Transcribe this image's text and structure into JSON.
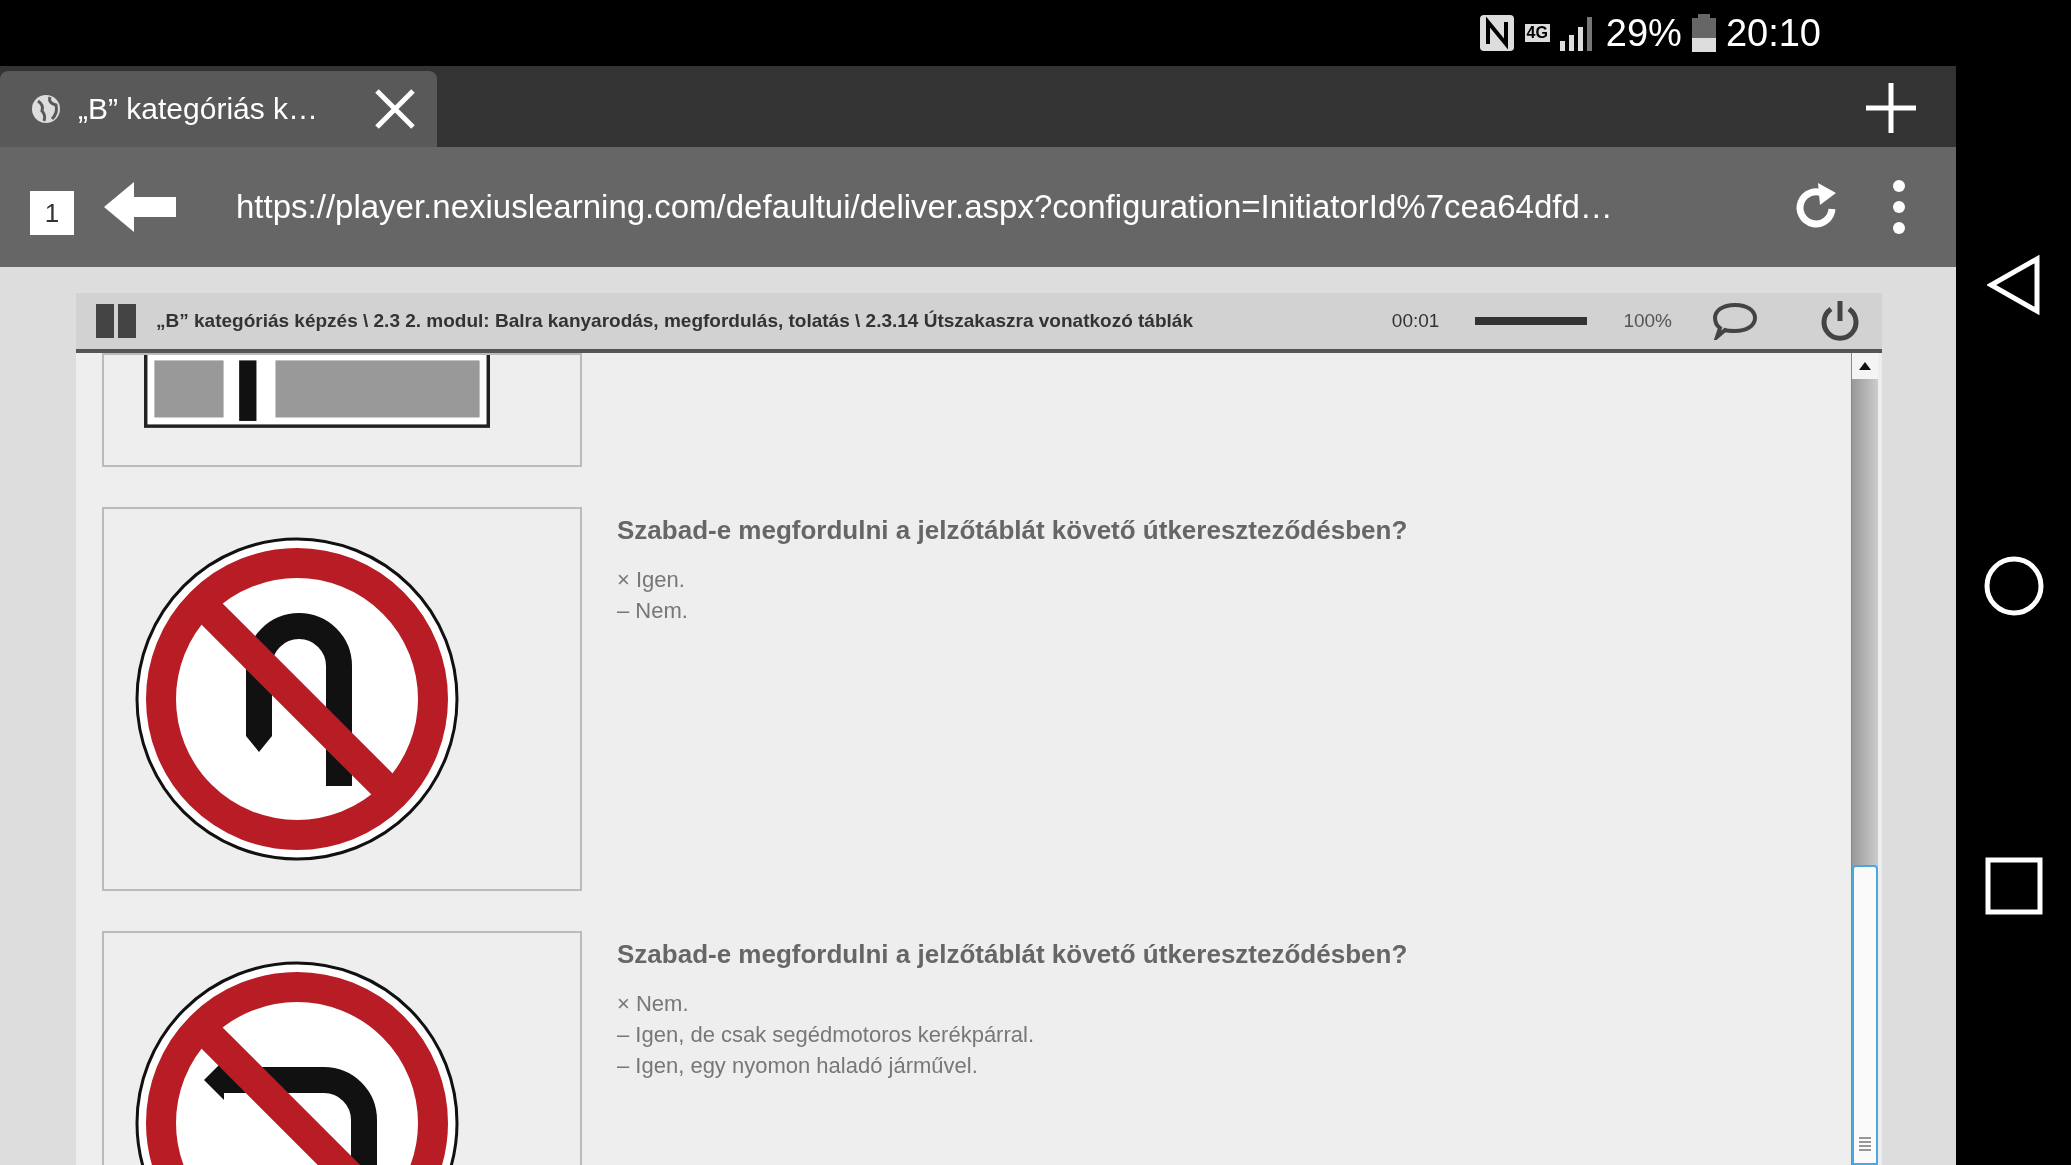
{
  "status_bar": {
    "network": "4G",
    "battery": "29%",
    "time": "20:10"
  },
  "browser": {
    "tab": {
      "title": "„B” kategóriás k…",
      "selected": true
    },
    "tab_count": "1",
    "url": "https://player.nexiuslearning.com/defaultui/deliver.aspx?configuration=InitiatorId%7cea64dfd…"
  },
  "player": {
    "breadcrumb": "„B” kategóriás képzés \\ 2.3 2. modul: Balra kanyarodás, megfordulás, tolatás \\ 2.3.14 Útszakaszra vonatkozó táblák",
    "elapsed": "00:01",
    "progress": {
      "level": 1,
      "reading": "100%"
    }
  },
  "questions": [
    {
      "sign": {
        "kind": "partial"
      }
    },
    {
      "sign": {
        "kind": "no-u-turn"
      },
      "question": "Szabad-e megfordulni a jelzőtáblát követő útkereszteződésben?",
      "answers": [
        "× Igen.",
        "– Nem."
      ]
    },
    {
      "sign": {
        "kind": "no-left-turn"
      },
      "question": "Szabad-e megfordulni a jelzőtáblát követő útkereszteződésben?",
      "answers": [
        "× Nem.",
        "– Igen, de csak segédmotoros kerékpárral.",
        "– Igen, egy nyomon haladó járművel."
      ]
    }
  ]
}
